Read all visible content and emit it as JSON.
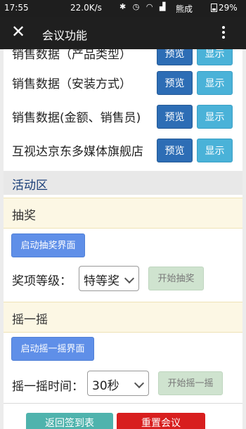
{
  "status_bar": {
    "time": "17:55",
    "network_speed": "22.0K/s",
    "carrier": "熊成",
    "battery": "29%"
  },
  "app_bar": {
    "close_icon": "close-icon",
    "title": "会议功能",
    "more_icon": "more-vert-icon"
  },
  "data_rows": [
    {
      "label": "销售数据（产品类型）",
      "preview": "预览",
      "show": "显示"
    },
    {
      "label": "销售数据（安装方式）",
      "preview": "预览",
      "show": "显示"
    },
    {
      "label": "销售数据(金额、销售员)",
      "preview": "预览",
      "show": "显示"
    },
    {
      "label": "互视达京东多媒体旗舰店",
      "preview": "预览",
      "show": "显示"
    }
  ],
  "activity": {
    "title": "活动区",
    "lottery": {
      "title": "抽奖",
      "launch_button": "启动抽奖界面",
      "level_label": "奖项等级：",
      "level_value": "特等奖",
      "start_button": "开始抽奖"
    },
    "shake": {
      "title": "摇一摇",
      "launch_button": "启动摇一摇界面",
      "time_label": "摇一摇时间：",
      "time_value": "30秒",
      "start_button": "开始摇一摇"
    }
  },
  "footer": {
    "back_button": "返回签到表",
    "reset_button": "重置会议"
  },
  "colors": {
    "appbar": "#1f1f1f",
    "preview_button": "#2d6db5",
    "show_button": "#4ab2d8",
    "section_title": "#1b3f79",
    "launch_button": "#5f8fe8",
    "back_button": "#4fb3ad",
    "reset_button": "#d81e1e"
  }
}
